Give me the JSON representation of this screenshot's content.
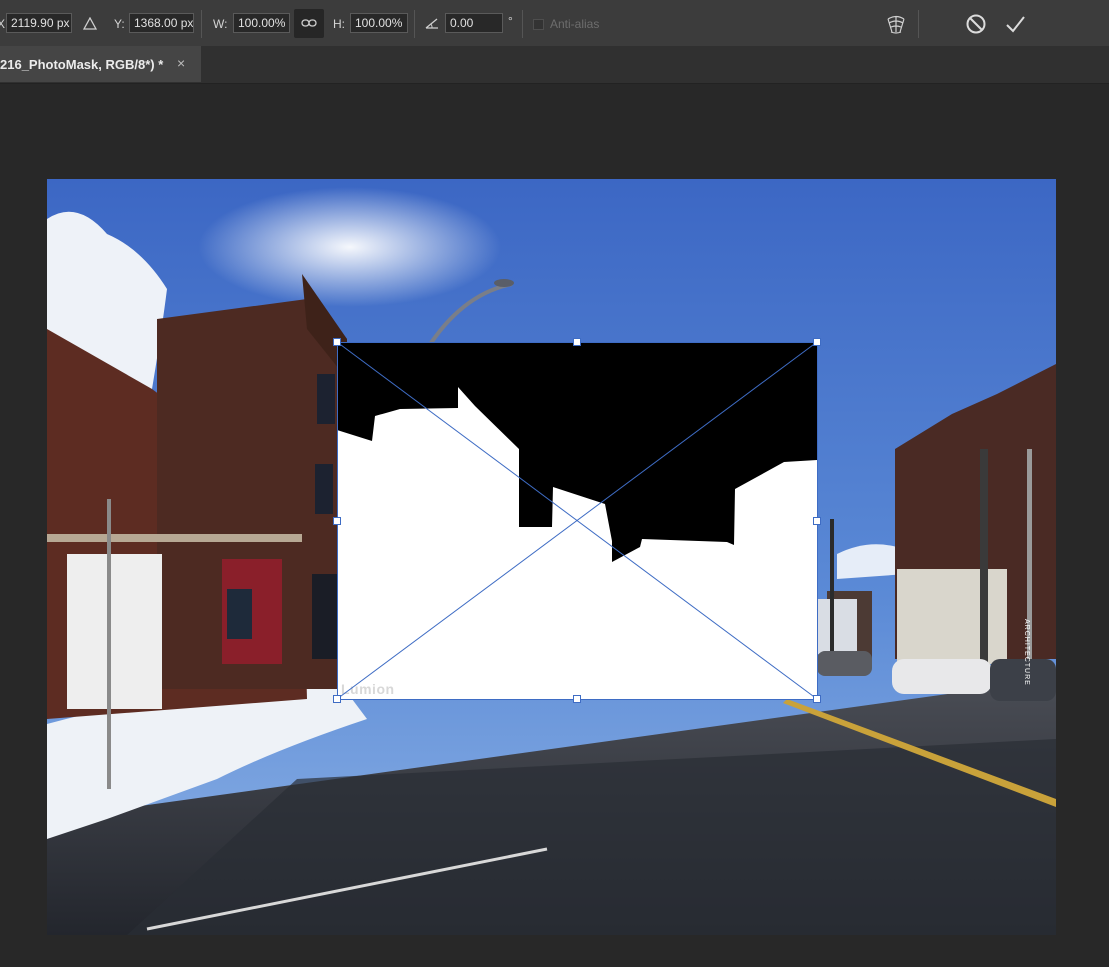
{
  "options_bar": {
    "x_label": "X:",
    "x_value": "2119.90 px",
    "y_label": "Y:",
    "y_value": "1368.00 px",
    "w_label": "W:",
    "w_value": "100.00%",
    "h_label": "H:",
    "h_value": "100.00%",
    "angle_value": "0.00",
    "degree_symbol": "°",
    "anti_alias_label": "Anti-alias",
    "anti_alias_checked": false
  },
  "document_tab": {
    "title": "216_PhotoMask, RGB/8*) *",
    "close_glyph": "×"
  },
  "canvas": {
    "watermark": "Lumion",
    "store_sign": "ARCHITECTURE"
  },
  "icons": {
    "reference_point": "triangle-delta-icon",
    "link": "link-icon",
    "angle": "angle-icon",
    "warp": "warp-icon",
    "cancel": "cancel-icon",
    "commit": "checkmark-icon"
  },
  "colors": {
    "selection_blue": "#3e6cc4",
    "mask_black": "#000000",
    "mask_white": "#ffffff"
  }
}
